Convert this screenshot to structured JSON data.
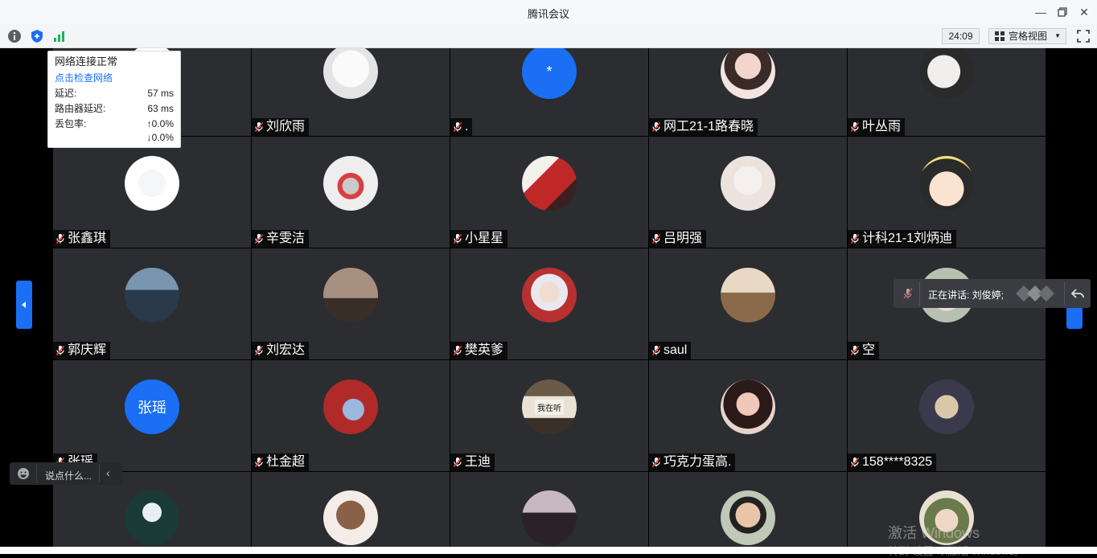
{
  "window": {
    "title": "腾讯会议"
  },
  "toolbar": {
    "timer": "24:09",
    "view_label": "宫格视图"
  },
  "network_popup": {
    "status": "网络连接正常",
    "check_link": "点击检查网络",
    "latency_label": "延迟:",
    "latency_value": "57 ms",
    "router_label": "路由器延迟:",
    "router_value": "63 ms",
    "loss_label": "丢包率:",
    "loss_up": "↑0.0%",
    "loss_down": "↓0.0%"
  },
  "participants": [
    {
      "name": "",
      "avatar": "hidden"
    },
    {
      "name": "刘欣雨",
      "avatar": "sketch"
    },
    {
      "name": ".",
      "avatar": "asterisk",
      "avatar_text": "*"
    },
    {
      "name": "网工21-1路春晓",
      "avatar": "girl-photo"
    },
    {
      "name": "叶丛雨",
      "avatar": "hamster"
    },
    {
      "name": "张鑫琪",
      "avatar": "cartoon-robot"
    },
    {
      "name": "辛雯洁",
      "avatar": "curling-stone"
    },
    {
      "name": "小星星",
      "avatar": "anime-girl"
    },
    {
      "name": "吕明强",
      "avatar": "rabbit"
    },
    {
      "name": "计科21-1刘炳迪",
      "avatar": "cartoon-girl"
    },
    {
      "name": "郭庆辉",
      "avatar": "man-photo"
    },
    {
      "name": "刘宏达",
      "avatar": "dusk-figure"
    },
    {
      "name": "樊英爹",
      "avatar": "anime-inuyasha"
    },
    {
      "name": "saul",
      "avatar": "astronaut"
    },
    {
      "name": "空",
      "avatar": "anime-pink"
    },
    {
      "name": "张瑶",
      "avatar": "text",
      "avatar_text": "张瑶"
    },
    {
      "name": "杜金超",
      "avatar": "illustration-red"
    },
    {
      "name": "王迪",
      "avatar": "sign-photo",
      "avatar_text": "我在听"
    },
    {
      "name": "巧克力蛋高.",
      "avatar": "girl-photo-2"
    },
    {
      "name": "158****8325",
      "avatar": "dark-cartoon"
    },
    {
      "name": "",
      "avatar": "hollow-knight"
    },
    {
      "name": "",
      "avatar": "bear"
    },
    {
      "name": "",
      "avatar": "girl-dark"
    },
    {
      "name": "",
      "avatar": "boy-photo"
    },
    {
      "name": "",
      "avatar": "girl-green-hat"
    }
  ],
  "speaker_panel": {
    "label": "正在讲话: 刘俊婷;"
  },
  "chat": {
    "placeholder": "说点什么..."
  },
  "watermark": {
    "line1": "激活 Windows",
    "line2": "转到\"设置\"以激活 Windows。"
  },
  "colors": {
    "accent": "#1a6ff5",
    "tile": "#2b2d31",
    "mute_red": "#e64545"
  }
}
